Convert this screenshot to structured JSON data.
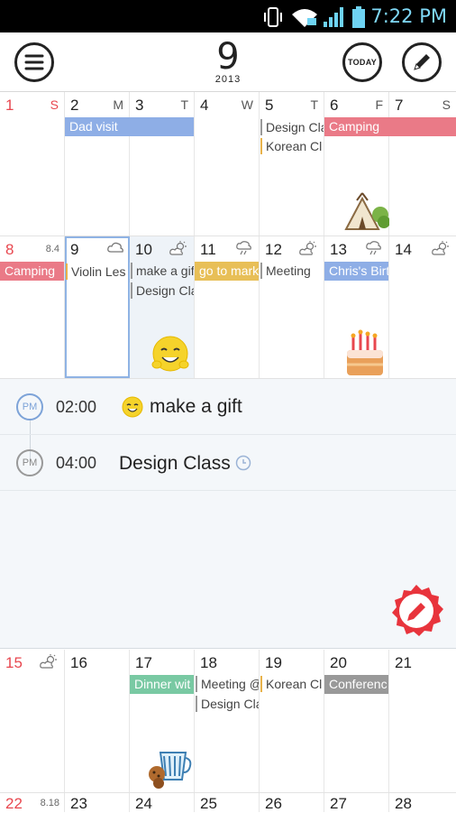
{
  "status_bar": {
    "time": "7:22 PM"
  },
  "header": {
    "month": "9",
    "year": "2013",
    "today_label": "TODAY"
  },
  "weekdays": [
    "S",
    "M",
    "T",
    "W",
    "T",
    "F",
    "S"
  ],
  "weeks": [
    {
      "days": [
        "1",
        "2",
        "3",
        "4",
        "5",
        "6",
        "7"
      ]
    },
    {
      "days": [
        "8",
        "9",
        "10",
        "11",
        "12",
        "13",
        "14"
      ],
      "lunar": "8.4"
    },
    {
      "days": [
        "15",
        "16",
        "17",
        "18",
        "19",
        "20",
        "21"
      ]
    },
    {
      "days": [
        "22",
        "23",
        "24",
        "25",
        "26",
        "27",
        "28"
      ],
      "lunar": "8.18"
    }
  ],
  "events": {
    "dad_visit": "Dad visit",
    "design_class_5": "Design Cla",
    "korean_class_5": "Korean Cl",
    "camping_6": "Camping",
    "camping_8": "Camping",
    "violin": "Violin Les",
    "make_gift": "make a gif",
    "design_class_10": "Design Cla",
    "market": "go to mark",
    "meeting_12": "Meeting",
    "chris_bday": "Chris's Birt",
    "dinner": "Dinner wit",
    "meeting_18": "Meeting @",
    "design_class_18": "Design Cla",
    "korean_class_19": "Korean Cl",
    "conference": "Conferenc"
  },
  "detail": {
    "items": [
      {
        "ampm": "PM",
        "time": "02:00",
        "title": "make a gift"
      },
      {
        "ampm": "PM",
        "time": "04:00",
        "title": "Design Class"
      }
    ]
  },
  "colors": {
    "blue_event": "#8eaee6",
    "pink_event": "#ea7a87",
    "yellow_event": "#e8bf57",
    "green_event": "#79c9a3",
    "gray_event": "#999999",
    "fab": "#e8343c"
  }
}
